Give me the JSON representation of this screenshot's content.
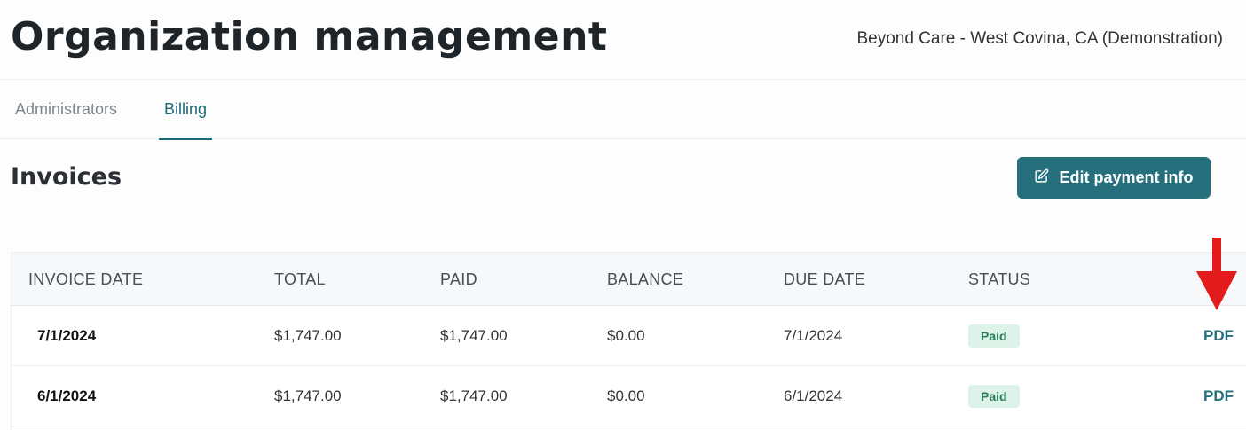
{
  "header": {
    "title": "Organization management",
    "organization": "Beyond Care - West Covina, CA (Demonstration)"
  },
  "tabs": [
    {
      "label": "Administrators",
      "active": false
    },
    {
      "label": "Billing",
      "active": true
    }
  ],
  "invoices": {
    "title": "Invoices",
    "edit_button_label": "Edit payment info",
    "edit_button_icon": "edit-icon",
    "columns": [
      "INVOICE DATE",
      "TOTAL",
      "PAID",
      "BALANCE",
      "DUE DATE",
      "STATUS"
    ],
    "rows": [
      {
        "invoice_date": "7/1/2024",
        "total": "$1,747.00",
        "paid": "$1,747.00",
        "balance": "$0.00",
        "due_date": "7/1/2024",
        "status": "Paid",
        "action": "PDF"
      },
      {
        "invoice_date": "6/1/2024",
        "total": "$1,747.00",
        "paid": "$1,747.00",
        "balance": "$0.00",
        "due_date": "6/1/2024",
        "status": "Paid",
        "action": "PDF"
      }
    ]
  },
  "colors": {
    "accent": "#26707e",
    "status_paid_bg": "#ddf3ea",
    "status_paid_text": "#2a7a5c",
    "annotation_arrow": "#e31b1b"
  },
  "annotation": {
    "icon": "red-down-arrow-icon"
  }
}
